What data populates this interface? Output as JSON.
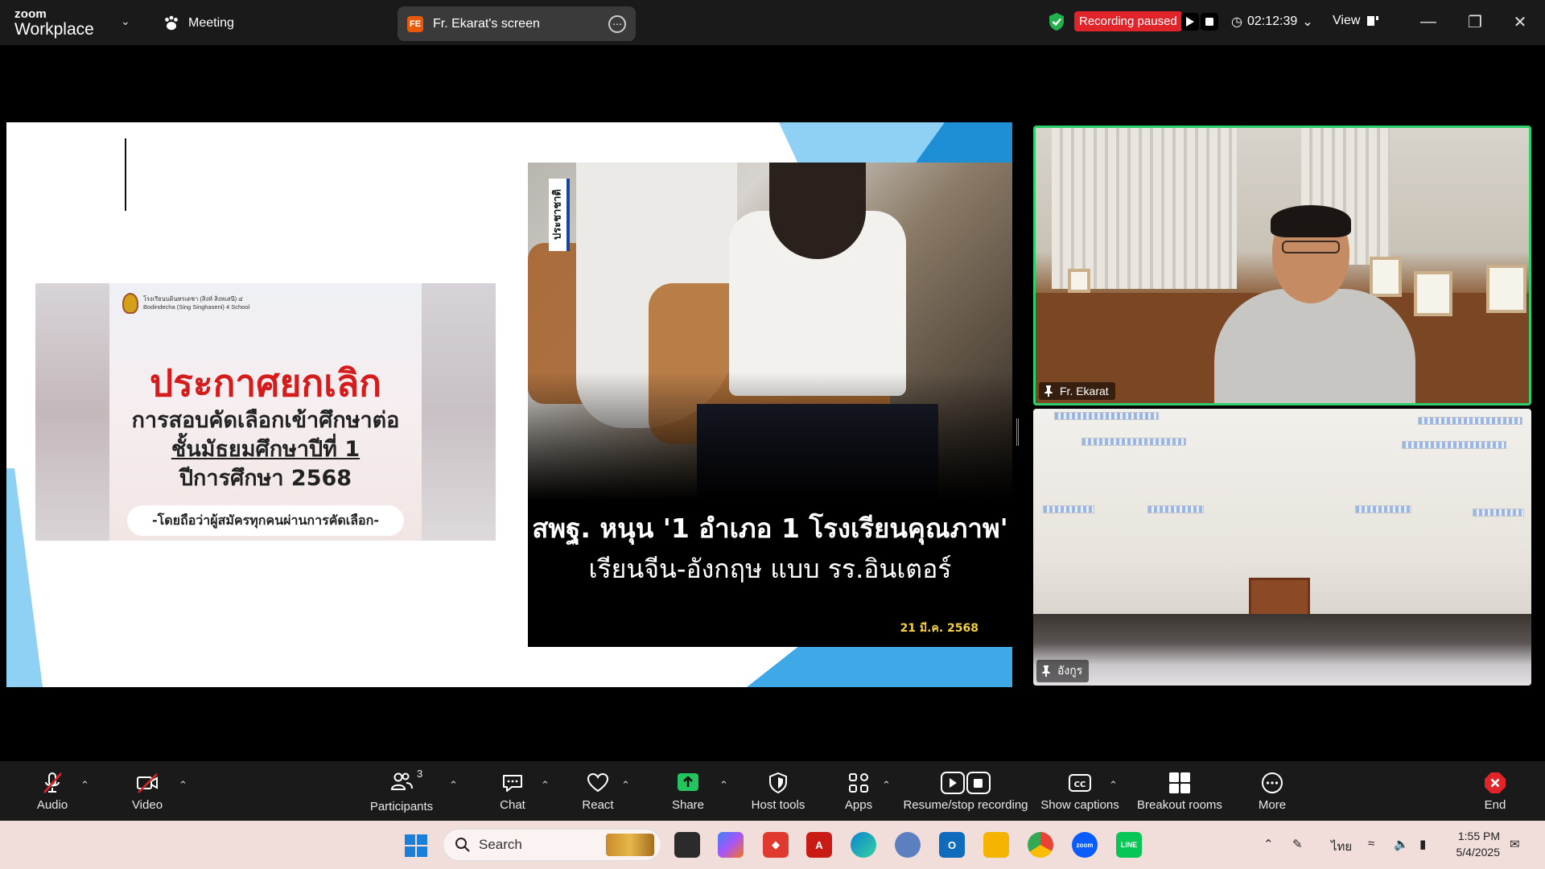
{
  "topbar": {
    "brand_line1": "zoom",
    "brand_line2": "Workplace",
    "meeting_label": "Meeting",
    "share_initials": "FE",
    "share_label": "Fr. Ekarat's screen",
    "recording_status": "Recording paused",
    "timer": "02:12:39",
    "view_label": "View",
    "colors": {
      "recording": "#e0242a",
      "shield": "#22b14c",
      "active_speaker": "#2fd06b"
    }
  },
  "slide": {
    "left_news": {
      "school_line1": "โรงเรียนบดินทรเดชา (สิงห์ สิงหเสนี) ๔",
      "school_line2": "Bodindecha (Sing Singhaseni) 4 School",
      "title": "ประกาศยกเลิก",
      "line2": "การสอบคัดเลือกเข้าศึกษาต่อ",
      "line3": "ชั้นมัธยมศึกษาปีที่ 1",
      "line4": "ปีการศึกษา 2568",
      "note": "-โดยถือว่าผู้สมัครทุกคนผ่านการคัดเลือก-"
    },
    "right_news": {
      "paper_logo": "ประชาชาติ",
      "headline": "สพฐ. หนุน '1 อำเภอ 1 โรงเรียนคุณภาพ'",
      "subhead": "เรียนจีน-อังกฤษ แบบ รร.อินเตอร์",
      "date": "21 มี.ค. 2568"
    }
  },
  "videos": [
    {
      "name": "Fr. Ekarat",
      "active": true
    },
    {
      "name": "อังกูร",
      "active": false
    }
  ],
  "toolbar": {
    "audio": "Audio",
    "video": "Video",
    "participants": "Participants",
    "participants_count": "3",
    "chat": "Chat",
    "react": "React",
    "share": "Share",
    "host_tools": "Host tools",
    "apps": "Apps",
    "recording": "Resume/stop recording",
    "captions": "Show captions",
    "breakout": "Breakout rooms",
    "more": "More",
    "end": "End"
  },
  "taskbar": {
    "search_placeholder": "Search",
    "language": "ไทย",
    "time": "1:55 PM",
    "date": "5/4/2025"
  }
}
